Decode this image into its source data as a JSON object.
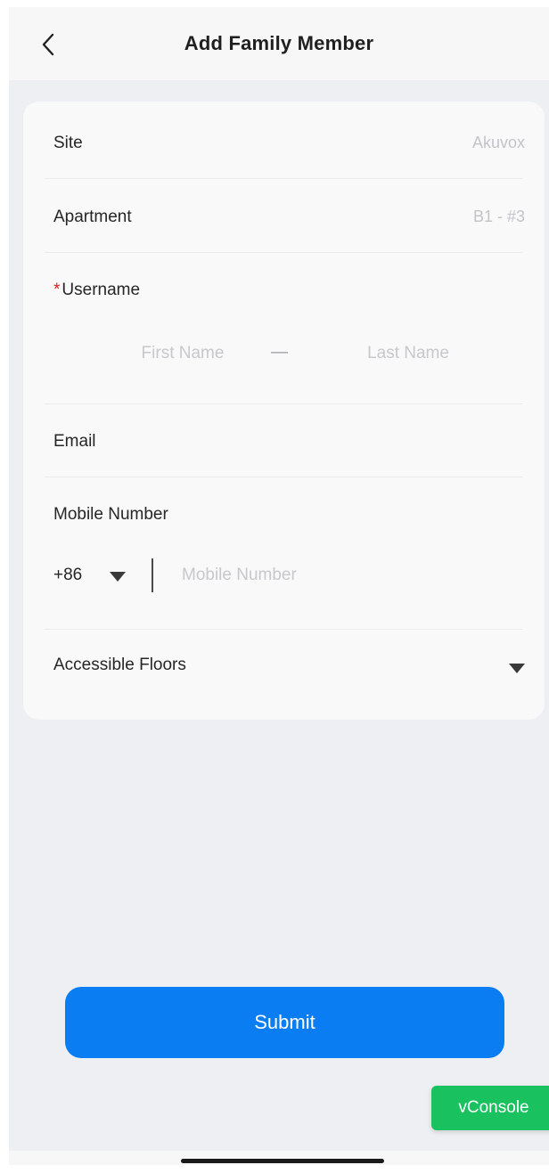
{
  "header": {
    "title": "Add Family Member",
    "back_icon": "chevron-left-icon"
  },
  "form": {
    "site": {
      "label": "Site",
      "value": "Akuvox"
    },
    "apartment": {
      "label": "Apartment",
      "value": "B1 - #3"
    },
    "username": {
      "required_mark": "*",
      "label": "Username",
      "first_name_placeholder": "First Name",
      "separator": "—",
      "last_name_placeholder": "Last Name"
    },
    "email": {
      "label": "Email"
    },
    "mobile": {
      "label": "Mobile Number",
      "country_code": "+86",
      "placeholder": "Mobile Number"
    },
    "accessible_floors": {
      "label": "Accessible Floors"
    }
  },
  "actions": {
    "submit_label": "Submit",
    "vconsole_label": "vConsole"
  },
  "colors": {
    "primary": "#0a7df3",
    "vconsole": "#19c15f",
    "required": "#e02020",
    "background": "#eeeff3"
  }
}
